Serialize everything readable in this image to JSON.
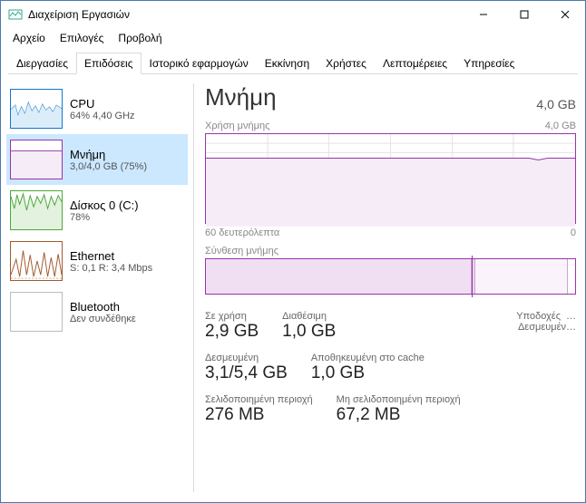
{
  "window": {
    "title": "Διαχείριση Εργασιών"
  },
  "menu": {
    "file": "Αρχείο",
    "options": "Επιλογές",
    "view": "Προβολή"
  },
  "tabs": {
    "processes": "Διεργασίες",
    "performance": "Επιδόσεις",
    "apphistory": "Ιστορικό εφαρμογών",
    "startup": "Εκκίνηση",
    "users": "Χρήστες",
    "details": "Λεπτομέρειες",
    "services": "Υπηρεσίες"
  },
  "sidebar": {
    "cpu": {
      "title": "CPU",
      "sub": "64% 4,40 GHz",
      "color": "#1178c8"
    },
    "memory": {
      "title": "Μνήμη",
      "sub": "3,0/4,0 GB (75%)",
      "color": "#9933aa"
    },
    "disk": {
      "title": "Δίσκος 0 (C:)",
      "sub": "78%",
      "color": "#4ca63a"
    },
    "ethernet": {
      "title": "Ethernet",
      "sub": "S: 0,1 R: 3,4 Mbps",
      "color": "#a05a2c"
    },
    "bluetooth": {
      "title": "Bluetooth",
      "sub": "Δεν συνδέθηκε",
      "color": "#bbbbbb"
    }
  },
  "main": {
    "title": "Μνήμη",
    "total": "4,0 GB",
    "usage_label": "Χρήση μνήμης",
    "usage_max": "4,0 GB",
    "time_axis_left": "60 δευτερόλεπτα",
    "time_axis_right": "0",
    "composition_label": "Σύνθεση μνήμης"
  },
  "stats": {
    "in_use": {
      "label": "Σε χρήση",
      "value": "2,9 GB"
    },
    "available": {
      "label": "Διαθέσιμη",
      "value": "1,0 GB"
    },
    "committed": {
      "label": "Δεσμευμένη",
      "value": "3,1/5,4 GB"
    },
    "cached": {
      "label": "Αποθηκευμένη στο cache",
      "value": "1,0 GB"
    },
    "paged": {
      "label": "Σελιδοποιημένη περιοχή",
      "value": "276 MB"
    },
    "nonpaged": {
      "label": "Μη σελιδοποιημένη περιοχή",
      "value": "67,2 MB"
    },
    "sockets": {
      "label": "Υποδοχές",
      "value": "…"
    },
    "reserved": {
      "label": "Δεσμευμέν…",
      "value": ""
    }
  },
  "chart_data": {
    "type": "area",
    "title": "Χρήση μνήμης",
    "ylabel": "GB",
    "ylim": [
      0,
      4.0
    ],
    "xlabel": "δευτερόλεπτα",
    "xlim": [
      60,
      0
    ],
    "series": [
      {
        "name": "Μνήμη",
        "values": [
          3.0,
          3.0,
          3.0,
          3.0,
          3.0,
          3.0,
          3.0,
          3.0,
          3.0,
          3.0,
          3.0,
          3.0,
          3.0,
          3.0,
          3.0,
          3.0,
          3.0,
          3.0,
          3.0,
          3.0,
          3.0,
          3.0,
          3.0,
          3.0,
          3.0,
          3.0,
          3.0,
          3.0,
          2.95,
          3.0
        ]
      }
    ],
    "composition": {
      "in_use_pct": 72,
      "modified_pct": 1,
      "standby_pct": 25,
      "free_pct": 2
    }
  }
}
